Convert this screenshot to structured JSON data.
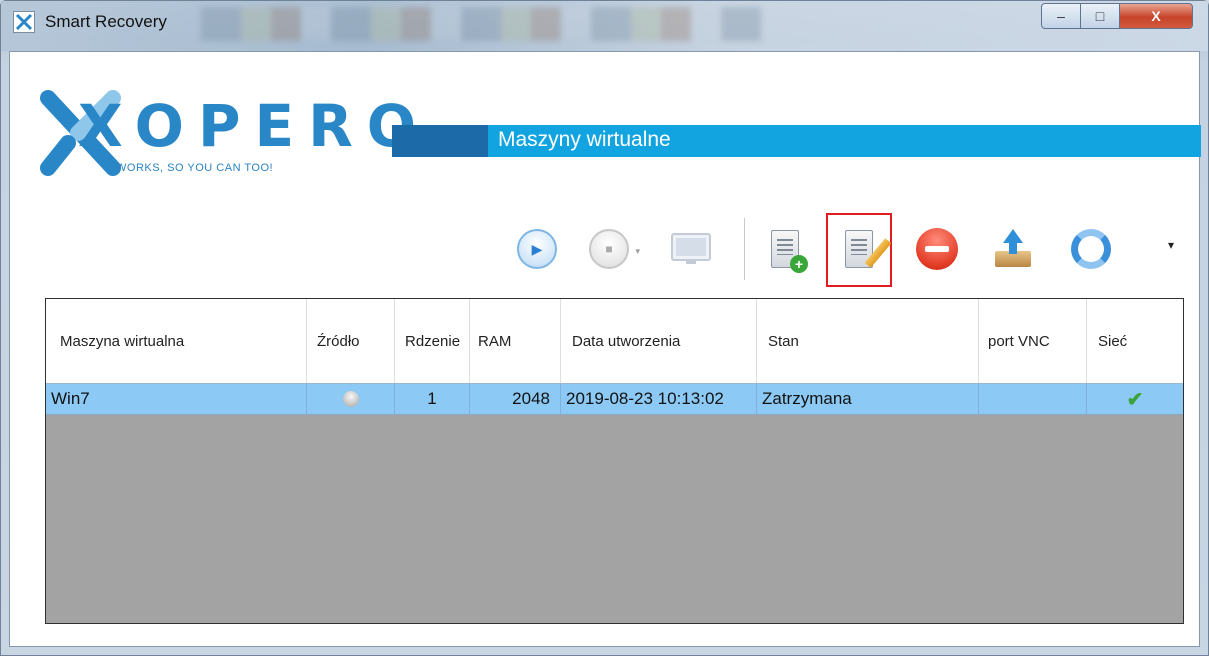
{
  "window": {
    "title": "Smart Recovery",
    "minimize": "–",
    "maximize": "□",
    "close": "X"
  },
  "logo": {
    "brand": "XOPERO",
    "tagline": "WORKS, SO YOU CAN TOO!"
  },
  "banner": {
    "title": "Maszyny wirtualne"
  },
  "toolbar": {
    "items": [
      {
        "name": "play-icon",
        "enabled": true
      },
      {
        "name": "stop-icon",
        "enabled": false
      },
      {
        "name": "console-icon",
        "enabled": false
      },
      {
        "name": "add-vm-icon",
        "enabled": true
      },
      {
        "name": "edit-vm-icon",
        "enabled": true,
        "highlighted": true
      },
      {
        "name": "remove-icon",
        "enabled": true
      },
      {
        "name": "export-icon",
        "enabled": true
      },
      {
        "name": "refresh-icon",
        "enabled": true
      }
    ],
    "more": "▾",
    "play_glyph": "▶",
    "stop_glyph": "■",
    "stop_dropdown": "▾"
  },
  "table": {
    "columns": [
      "Maszyna wirtualna",
      "Źródło",
      "Rdzenie",
      "RAM",
      "Data utworzenia",
      "Stan",
      "port VNC",
      "Sieć"
    ],
    "rows": [
      {
        "name": "Win7",
        "source_icon": "person-icon",
        "cores": "1",
        "ram": "2048",
        "created": "2019-08-23 10:13:02",
        "state": "Zatrzymana",
        "vnc": "",
        "network": "✔"
      }
    ]
  },
  "colors": {
    "accent": "#12a4e0",
    "accent_dark": "#1c6aa7",
    "selected_row": "#8ccaf5",
    "highlight_frame": "#e01b22"
  }
}
